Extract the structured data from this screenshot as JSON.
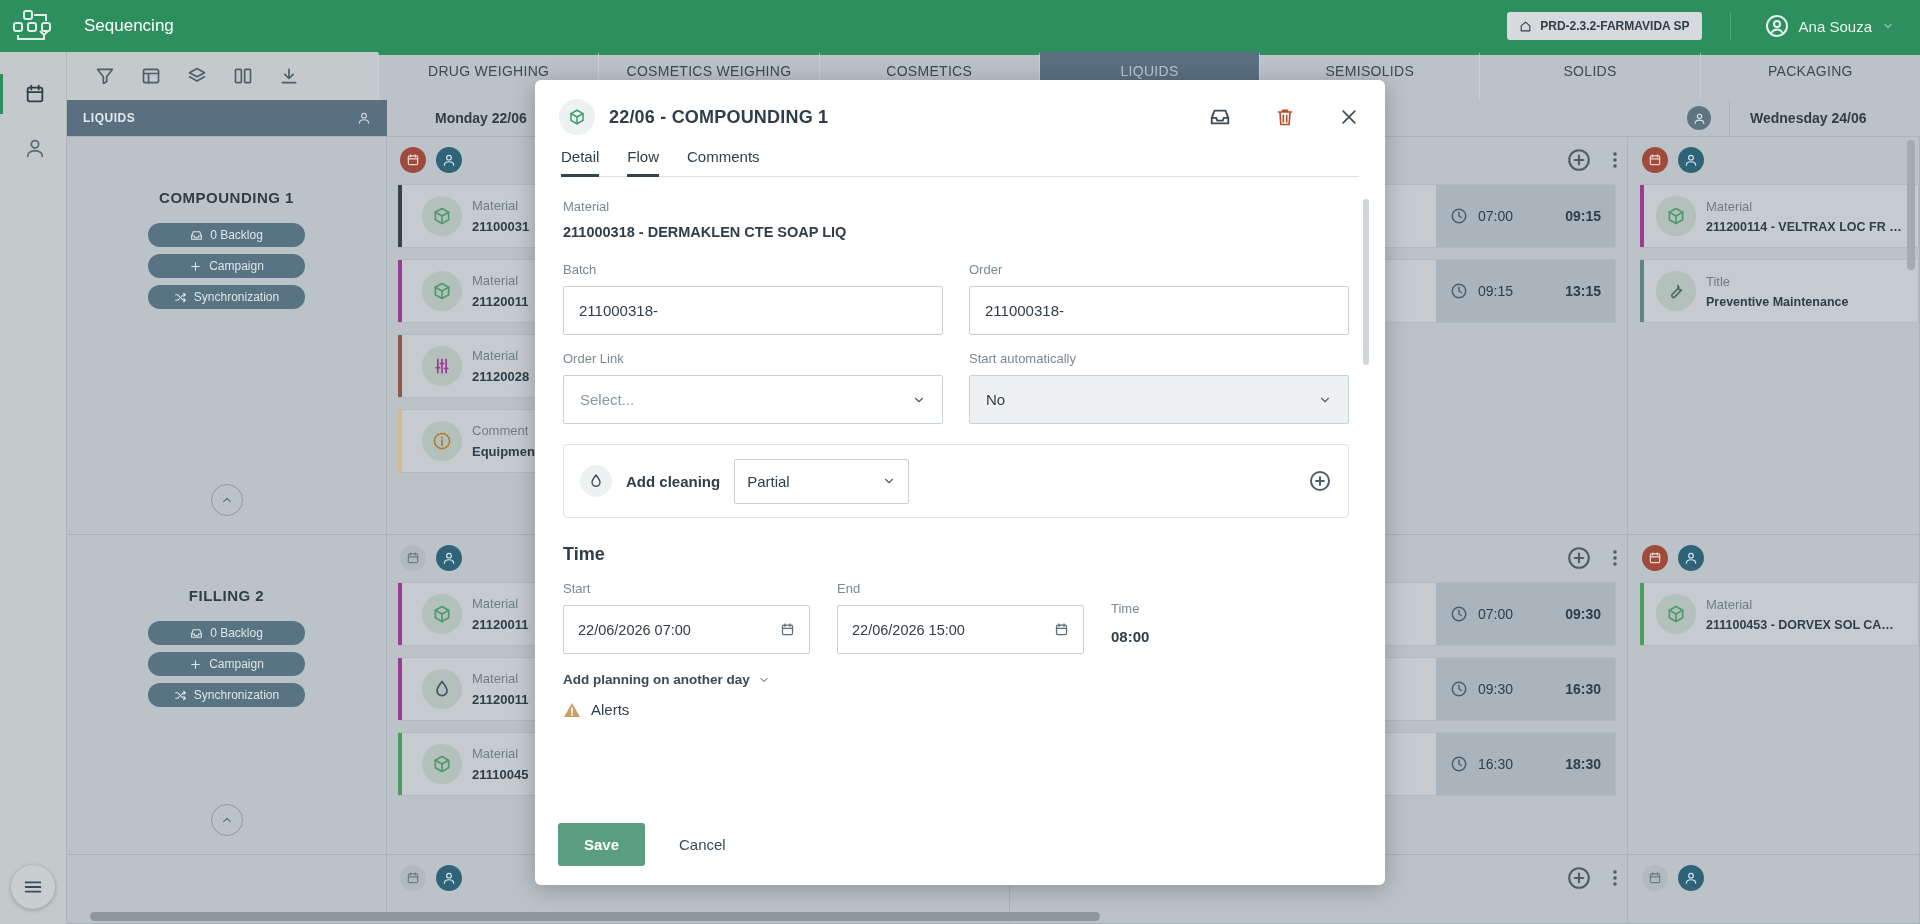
{
  "app_bar": {
    "title": "Sequencing",
    "environment": "PRD-2.3.2-FARMAVIDA SP",
    "user": "Ana Souza"
  },
  "side_rail": [
    {
      "selected": true
    },
    {
      "selected": false
    }
  ],
  "area_tabs": [
    {
      "label": "DRUG WEIGHING",
      "selected": false
    },
    {
      "label": "COSMETICS WEIGHING",
      "selected": false
    },
    {
      "label": "COSMETICS",
      "selected": false
    },
    {
      "label": "LIQUIDS",
      "selected": true
    },
    {
      "label": "SEMISOLIDS",
      "selected": false
    },
    {
      "label": "SOLIDS",
      "selected": false
    },
    {
      "label": "PACKAGING",
      "selected": false
    }
  ],
  "schedule": {
    "panel_title": "LIQUIDS",
    "day_headers": [
      "Monday 22/06",
      "Wednesday 24/06"
    ],
    "stations": [
      {
        "name": "COMPOUNDING 1",
        "actions": [
          {
            "kind": "backlog",
            "label": "0 Backlog"
          },
          {
            "kind": "campaign",
            "label": "Campaign"
          },
          {
            "kind": "sync",
            "label": "Synchronization"
          }
        ],
        "monday": {
          "calendar_alert": true,
          "cards": [
            {
              "kind": "cube",
              "label": "Material",
              "value": "21100031",
              "color": "#36434d"
            },
            {
              "kind": "cube",
              "label": "Material",
              "value": "21120011",
              "color": "#9c3a95"
            },
            {
              "kind": "sliders",
              "label": "Material",
              "value": "21120028",
              "color": "#8e5a45"
            },
            {
              "kind": "info",
              "label": "Comment",
              "value": "Equipmen",
              "color": "#d8b88e"
            }
          ]
        },
        "tuesday": {
          "slots": [
            {
              "start": "07:00",
              "end": "09:15"
            },
            {
              "start": "09:15",
              "end": "13:15"
            }
          ]
        },
        "wednesday": {
          "calendar_alert": true,
          "cards": [
            {
              "kind": "cube",
              "label": "Material",
              "value": "211200114 - VELTRAX LOC FR …",
              "color": "#9c3a95"
            },
            {
              "kind": "wrench",
              "label": "Title",
              "value": "Preventive Maintenance",
              "color": "#60857a"
            }
          ]
        }
      },
      {
        "name": "FILLING 2",
        "actions": [
          {
            "kind": "backlog",
            "label": "0 Backlog"
          },
          {
            "kind": "campaign",
            "label": "Campaign"
          },
          {
            "kind": "sync",
            "label": "Synchronization"
          }
        ],
        "monday": {
          "calendar_alert": false,
          "cards": [
            {
              "kind": "cube",
              "label": "Material",
              "value": "21120011",
              "color": "#9c3a95"
            },
            {
              "kind": "drop",
              "label": "Material",
              "value": "21120011",
              "color": "#9c3a95"
            },
            {
              "kind": "cube",
              "label": "Material",
              "value": "21110045",
              "color": "#4a9e5c"
            }
          ]
        },
        "tuesday": {
          "slots": [
            {
              "start": "07:00",
              "end": "09:30"
            },
            {
              "start": "09:30",
              "end": "16:30"
            },
            {
              "start": "16:30",
              "end": "18:30"
            }
          ]
        },
        "wednesday": {
          "calendar_alert": true,
          "cards": [
            {
              "kind": "cube",
              "label": "Material",
              "value": "211100453 - DORVEX SOL CA…",
              "color": "#4a9e5c"
            }
          ]
        }
      },
      {
        "monday": {
          "calendar_alert": false
        },
        "wednesday": {
          "calendar_alert": false
        }
      }
    ]
  },
  "modal": {
    "title": "22/06 - COMPOUNDING 1",
    "tabs": [
      {
        "label": "Detail",
        "selected": true
      },
      {
        "label": "Flow",
        "selected": true
      },
      {
        "label": "Comments",
        "selected": false
      }
    ],
    "material": {
      "label": "Material",
      "value": "211000318 - DERMAKLEN CTE SOAP LIQ"
    },
    "fields": [
      {
        "kind": "text",
        "label": "Batch",
        "value": "211000318-"
      },
      {
        "kind": "text",
        "label": "Order",
        "value": "211000318-"
      },
      {
        "kind": "select",
        "label": "Order Link",
        "placeholder": "Select...",
        "disabled": false
      },
      {
        "kind": "select",
        "label": "Start automatically",
        "value": "No",
        "disabled": true
      }
    ],
    "cleaning": {
      "label": "Add cleaning",
      "value": "Partial"
    },
    "time": {
      "heading": "Time",
      "start": {
        "label": "Start",
        "value": "22/06/2026 07:00"
      },
      "end": {
        "label": "End",
        "value": "22/06/2026 15:00"
      },
      "duration": {
        "label": "Time",
        "value": "08:00"
      }
    },
    "add_planning": "Add planning on another day",
    "alerts": "Alerts",
    "buttons": {
      "save": "Save",
      "cancel": "Cancel"
    }
  }
}
